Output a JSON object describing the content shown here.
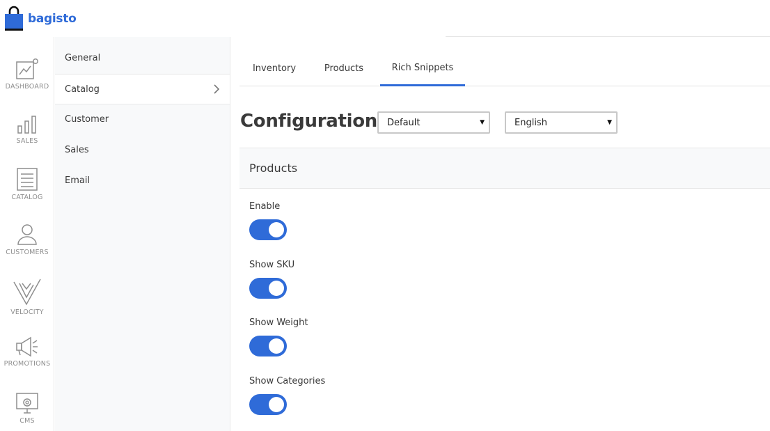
{
  "app": {
    "brand": "bagisto"
  },
  "nav": {
    "items": [
      {
        "label": "DASHBOARD",
        "icon": "dashboard-chart-icon"
      },
      {
        "label": "SALES",
        "icon": "bar-chart-icon"
      },
      {
        "label": "CATALOG",
        "icon": "document-list-icon"
      },
      {
        "label": "CUSTOMERS",
        "icon": "user-icon"
      },
      {
        "label": "VELOCITY",
        "icon": "velocity-v-icon"
      },
      {
        "label": "PROMOTIONS",
        "icon": "megaphone-icon"
      },
      {
        "label": "CMS",
        "icon": "monitor-gear-icon"
      }
    ]
  },
  "subnav": {
    "items": [
      {
        "label": "General"
      },
      {
        "label": "Catalog",
        "active": true
      },
      {
        "label": "Customer"
      },
      {
        "label": "Sales"
      },
      {
        "label": "Email"
      }
    ]
  },
  "tabs": [
    {
      "label": "Inventory"
    },
    {
      "label": "Products"
    },
    {
      "label": "Rich Snippets",
      "active": true
    }
  ],
  "page": {
    "title": "Configuration",
    "channel_select": "Default",
    "locale_select": "English"
  },
  "section": {
    "title": "Products",
    "fields": [
      {
        "label": "Enable",
        "enabled": true
      },
      {
        "label": "Show SKU",
        "enabled": true
      },
      {
        "label": "Show Weight",
        "enabled": true
      },
      {
        "label": "Show Categories",
        "enabled": true
      }
    ]
  },
  "colors": {
    "accent": "#2f6bd8",
    "icon_gray": "#8e8e8e"
  }
}
